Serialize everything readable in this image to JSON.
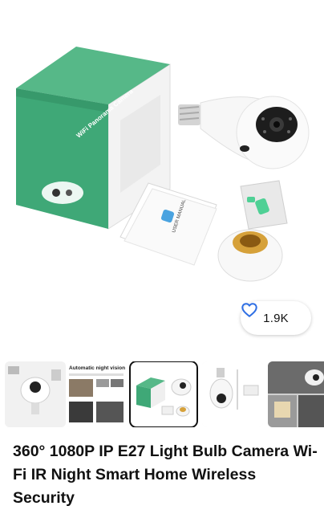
{
  "product": {
    "title": "360° 1080P IP E27 Light Bulb Camera Wi-Fi IR Night Smart Home Wireless Security",
    "box_label": "WiFi Panorama Camera",
    "manual_label": "USER MANUAL"
  },
  "likes": {
    "count": "1.9K",
    "icon": "heart-outline-icon",
    "icon_color": "#2f6fe4"
  },
  "thumbnails": [
    {
      "caption": ""
    },
    {
      "caption": "Automatic night vision"
    },
    {
      "caption": "",
      "selected": true
    },
    {
      "caption": ""
    },
    {
      "caption": ""
    }
  ],
  "colors": {
    "box_green": "#3fa877",
    "box_green_dark": "#2f8a60",
    "text": "#111111"
  }
}
